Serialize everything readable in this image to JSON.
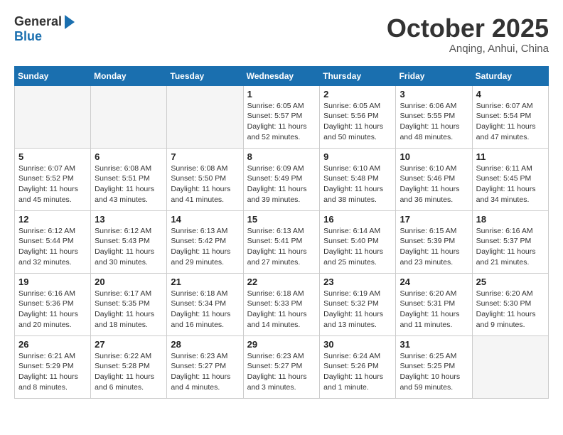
{
  "header": {
    "logo_general": "General",
    "logo_blue": "Blue",
    "month": "October 2025",
    "location": "Anqing, Anhui, China"
  },
  "days_of_week": [
    "Sunday",
    "Monday",
    "Tuesday",
    "Wednesday",
    "Thursday",
    "Friday",
    "Saturday"
  ],
  "weeks": [
    [
      {
        "day": "",
        "empty": true
      },
      {
        "day": "",
        "empty": true
      },
      {
        "day": "",
        "empty": true
      },
      {
        "day": "1",
        "sunrise": "6:05 AM",
        "sunset": "5:57 PM",
        "daylight": "11 hours and 52 minutes."
      },
      {
        "day": "2",
        "sunrise": "6:05 AM",
        "sunset": "5:56 PM",
        "daylight": "11 hours and 50 minutes."
      },
      {
        "day": "3",
        "sunrise": "6:06 AM",
        "sunset": "5:55 PM",
        "daylight": "11 hours and 48 minutes."
      },
      {
        "day": "4",
        "sunrise": "6:07 AM",
        "sunset": "5:54 PM",
        "daylight": "11 hours and 47 minutes."
      }
    ],
    [
      {
        "day": "5",
        "sunrise": "6:07 AM",
        "sunset": "5:52 PM",
        "daylight": "11 hours and 45 minutes."
      },
      {
        "day": "6",
        "sunrise": "6:08 AM",
        "sunset": "5:51 PM",
        "daylight": "11 hours and 43 minutes."
      },
      {
        "day": "7",
        "sunrise": "6:08 AM",
        "sunset": "5:50 PM",
        "daylight": "11 hours and 41 minutes."
      },
      {
        "day": "8",
        "sunrise": "6:09 AM",
        "sunset": "5:49 PM",
        "daylight": "11 hours and 39 minutes."
      },
      {
        "day": "9",
        "sunrise": "6:10 AM",
        "sunset": "5:48 PM",
        "daylight": "11 hours and 38 minutes."
      },
      {
        "day": "10",
        "sunrise": "6:10 AM",
        "sunset": "5:46 PM",
        "daylight": "11 hours and 36 minutes."
      },
      {
        "day": "11",
        "sunrise": "6:11 AM",
        "sunset": "5:45 PM",
        "daylight": "11 hours and 34 minutes."
      }
    ],
    [
      {
        "day": "12",
        "sunrise": "6:12 AM",
        "sunset": "5:44 PM",
        "daylight": "11 hours and 32 minutes."
      },
      {
        "day": "13",
        "sunrise": "6:12 AM",
        "sunset": "5:43 PM",
        "daylight": "11 hours and 30 minutes."
      },
      {
        "day": "14",
        "sunrise": "6:13 AM",
        "sunset": "5:42 PM",
        "daylight": "11 hours and 29 minutes."
      },
      {
        "day": "15",
        "sunrise": "6:13 AM",
        "sunset": "5:41 PM",
        "daylight": "11 hours and 27 minutes."
      },
      {
        "day": "16",
        "sunrise": "6:14 AM",
        "sunset": "5:40 PM",
        "daylight": "11 hours and 25 minutes."
      },
      {
        "day": "17",
        "sunrise": "6:15 AM",
        "sunset": "5:39 PM",
        "daylight": "11 hours and 23 minutes."
      },
      {
        "day": "18",
        "sunrise": "6:16 AM",
        "sunset": "5:37 PM",
        "daylight": "11 hours and 21 minutes."
      }
    ],
    [
      {
        "day": "19",
        "sunrise": "6:16 AM",
        "sunset": "5:36 PM",
        "daylight": "11 hours and 20 minutes."
      },
      {
        "day": "20",
        "sunrise": "6:17 AM",
        "sunset": "5:35 PM",
        "daylight": "11 hours and 18 minutes."
      },
      {
        "day": "21",
        "sunrise": "6:18 AM",
        "sunset": "5:34 PM",
        "daylight": "11 hours and 16 minutes."
      },
      {
        "day": "22",
        "sunrise": "6:18 AM",
        "sunset": "5:33 PM",
        "daylight": "11 hours and 14 minutes."
      },
      {
        "day": "23",
        "sunrise": "6:19 AM",
        "sunset": "5:32 PM",
        "daylight": "11 hours and 13 minutes."
      },
      {
        "day": "24",
        "sunrise": "6:20 AM",
        "sunset": "5:31 PM",
        "daylight": "11 hours and 11 minutes."
      },
      {
        "day": "25",
        "sunrise": "6:20 AM",
        "sunset": "5:30 PM",
        "daylight": "11 hours and 9 minutes."
      }
    ],
    [
      {
        "day": "26",
        "sunrise": "6:21 AM",
        "sunset": "5:29 PM",
        "daylight": "11 hours and 8 minutes."
      },
      {
        "day": "27",
        "sunrise": "6:22 AM",
        "sunset": "5:28 PM",
        "daylight": "11 hours and 6 minutes."
      },
      {
        "day": "28",
        "sunrise": "6:23 AM",
        "sunset": "5:27 PM",
        "daylight": "11 hours and 4 minutes."
      },
      {
        "day": "29",
        "sunrise": "6:23 AM",
        "sunset": "5:27 PM",
        "daylight": "11 hours and 3 minutes."
      },
      {
        "day": "30",
        "sunrise": "6:24 AM",
        "sunset": "5:26 PM",
        "daylight": "11 hours and 1 minute."
      },
      {
        "day": "31",
        "sunrise": "6:25 AM",
        "sunset": "5:25 PM",
        "daylight": "10 hours and 59 minutes."
      },
      {
        "day": "",
        "empty": true
      }
    ]
  ]
}
